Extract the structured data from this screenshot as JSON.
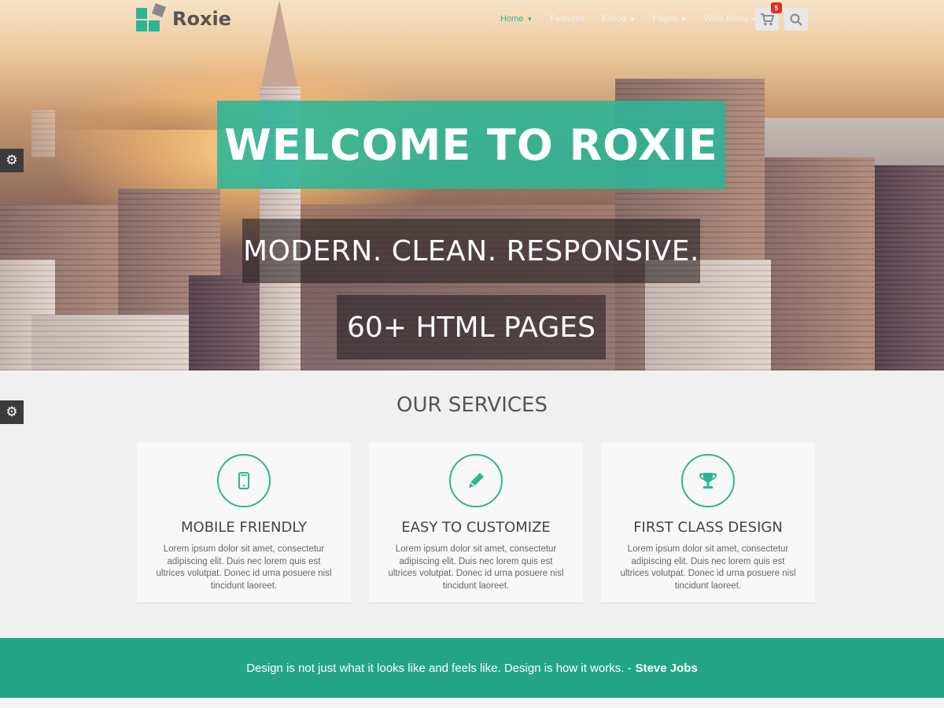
{
  "header": {
    "logo_text": "Roxie",
    "nav": [
      {
        "label": "Home",
        "has_dropdown": true,
        "active": true
      },
      {
        "label": "Features",
        "has_dropdown": false,
        "active": false
      },
      {
        "label": "Eshop",
        "has_dropdown": true,
        "active": false
      },
      {
        "label": "Pages",
        "has_dropdown": true,
        "active": false
      },
      {
        "label": "Wide Menu",
        "has_dropdown": true,
        "active": false
      }
    ],
    "cart_count": "5",
    "cart_icon": "shopping-cart-icon",
    "search_icon": "search-icon"
  },
  "hero": {
    "title": "WELCOME TO ROXIE",
    "subtitle1": "MODERN. CLEAN. RESPONSIVE.",
    "subtitle2": "60+ HTML PAGES"
  },
  "services": {
    "title": "OUR SERVICES",
    "items": [
      {
        "icon": "mobile-phone-icon",
        "title": "MOBILE FRIENDLY",
        "text": "Lorem ipsum dolor sit amet, consectetur adipiscing elit. Duis nec lorem quis est ultrices volutpat. Donec id urna posuere nisl tincidunt laoreet."
      },
      {
        "icon": "pencil-icon",
        "title": "EASY TO CUSTOMIZE",
        "text": "Lorem ipsum dolor sit amet, consectetur adipiscing elit. Duis nec lorem quis est ultrices volutpat. Donec id urna posuere nisl tincidunt laoreet."
      },
      {
        "icon": "trophy-icon",
        "title": "FIRST CLASS DESIGN",
        "text": "Lorem ipsum dolor sit amet, consectetur adipiscing elit. Duis nec lorem quis est ultrices volutpat. Donec id urna posuere nisl tincidunt laoreet."
      }
    ]
  },
  "quote": {
    "text": "Design is not just what it looks like and feels like. Design is how it works. -",
    "author": "Steve Jobs"
  },
  "colors": {
    "accent": "#2bb596",
    "quote_bar": "#23a586",
    "badge": "#d9302c"
  }
}
